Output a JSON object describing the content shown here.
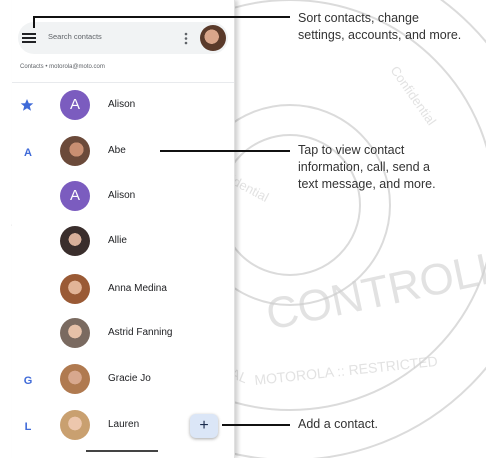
{
  "screen": {
    "search_placeholder": "Search contacts",
    "account_label": "Contacts • motorola@moto.com",
    "contacts": [
      {
        "section": "★",
        "avatar_letter": "A",
        "name": "Alison"
      },
      {
        "section": "A",
        "avatar_letter": "",
        "name": "Abe"
      },
      {
        "section": "",
        "avatar_letter": "A",
        "name": "Alison"
      },
      {
        "section": "",
        "avatar_letter": "",
        "name": "Allie"
      },
      {
        "section": "",
        "avatar_letter": "",
        "name": "Anna Medina"
      },
      {
        "section": "",
        "avatar_letter": "",
        "name": "Astrid Fanning"
      },
      {
        "section": "G",
        "avatar_letter": "",
        "name": "Gracie Jo"
      },
      {
        "section": "L",
        "avatar_letter": "",
        "name": "Lauren"
      }
    ],
    "fab_label": "+"
  },
  "callouts": {
    "menu": [
      "Sort contacts, change",
      "settings, accounts, and more."
    ],
    "contact": [
      "Tap to view contact",
      "information, call, send a",
      "text message, and more."
    ],
    "add": [
      "Add a contact."
    ]
  },
  "colors": {
    "accent": "#3f6ad8",
    "avatar_purple": "#7b5cbf",
    "fab_bg": "#dbe6f7"
  }
}
